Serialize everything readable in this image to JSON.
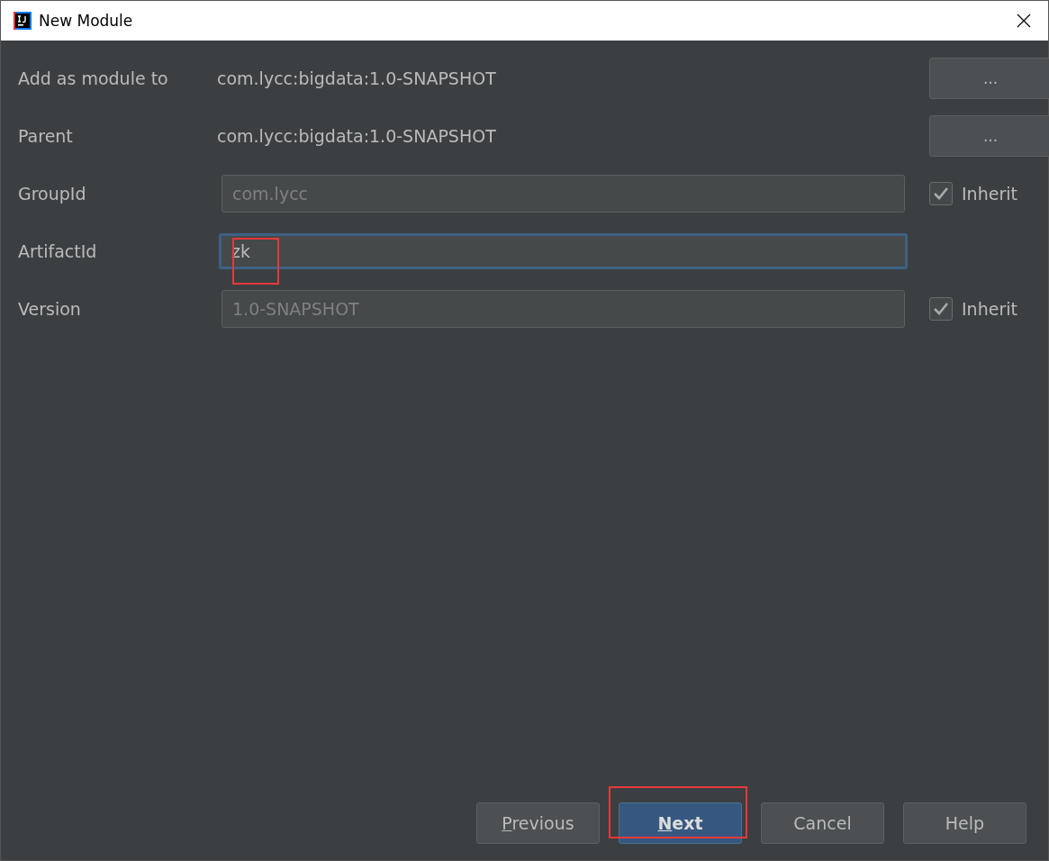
{
  "window": {
    "title": "New Module"
  },
  "rows": [
    {
      "label": "Add as module to",
      "kind": "text",
      "value": "com.lycc:bigdata:1.0-SNAPSHOT",
      "trailer": {
        "kind": "browse",
        "label": "..."
      }
    },
    {
      "label": "Parent",
      "kind": "text",
      "value": "com.lycc:bigdata:1.0-SNAPSHOT",
      "trailer": {
        "kind": "browse",
        "label": "..."
      }
    },
    {
      "label": "GroupId",
      "kind": "field",
      "value": "com.lycc",
      "disabled": true,
      "focused": false,
      "annotated": false,
      "trailer": {
        "kind": "checkbox",
        "label": "Inherit",
        "checked": true
      }
    },
    {
      "label": "ArtifactId",
      "kind": "field",
      "value": "zk",
      "disabled": false,
      "focused": true,
      "annotated": true
    },
    {
      "label": "Version",
      "kind": "field",
      "value": "1.0-SNAPSHOT",
      "disabled": true,
      "focused": false,
      "annotated": false,
      "trailer": {
        "kind": "checkbox",
        "label": "Inherit",
        "checked": true
      }
    }
  ],
  "buttons": [
    {
      "label": "Previous",
      "underline_first": true,
      "default": false,
      "annotated": false
    },
    {
      "label": "Next",
      "underline_first": true,
      "default": true,
      "annotated": true
    },
    {
      "label": "Cancel",
      "underline_first": false,
      "default": false,
      "annotated": false
    },
    {
      "label": "Help",
      "underline_first": false,
      "default": false,
      "annotated": false
    }
  ]
}
